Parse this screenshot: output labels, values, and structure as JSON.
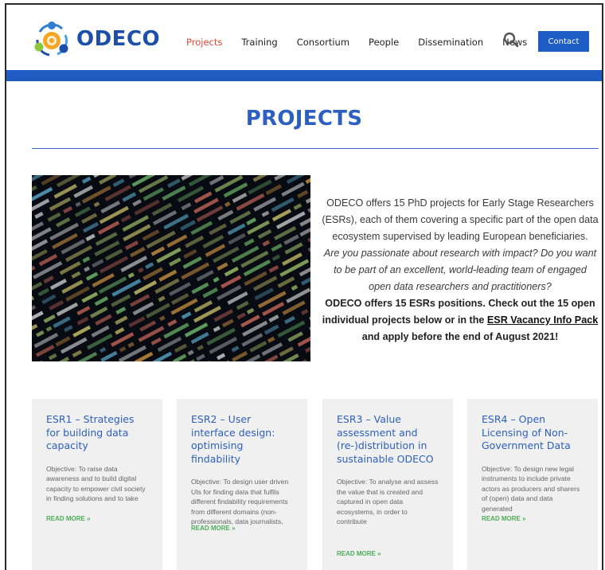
{
  "brand": {
    "name": "ODECO"
  },
  "nav": {
    "items": [
      {
        "label": "Projects",
        "active": true
      },
      {
        "label": "Training",
        "active": false
      },
      {
        "label": "Consortium",
        "active": false
      },
      {
        "label": "People",
        "active": false
      },
      {
        "label": "Dissemination",
        "active": false
      },
      {
        "label": "News",
        "active": false
      }
    ],
    "search_icon": "search-icon",
    "contact_label": "Contact"
  },
  "colors": {
    "primary": "#1f5bc2",
    "active_nav": "#e0483a",
    "read_more": "#4cae59",
    "card_bg": "#f1f0f0"
  },
  "page": {
    "title": "PROJECTS"
  },
  "intro": {
    "lead": "ODECO offers 15 PhD projects for Early Stage Researchers (ESRs), each of them covering a specific part of the open data ecosystem supervised by leading European beneficiaries.",
    "question": "Are you passionate about research with impact? Do you want to be part of an excellent, world-leading team of engaged open data researchers and practitioners?",
    "cta_before": "ODECO offers 15 ESRs positions. Check out the 15 open individual projects below or in the ",
    "cta_link": "ESR Vacancy Info Pack",
    "cta_after": " and apply before the end of August 2021!"
  },
  "projects": [
    {
      "title": "ESR1 – Strategies for building data capacity",
      "desc": "Objective: To raise data awareness and to build digital capacity to empower civil society in finding solutions and to take",
      "more": "READ MORE »"
    },
    {
      "title": "ESR2 – User interface design: optimising findability",
      "desc": "Objective: To design user driven UIs for finding data that fulfils different findability requirements from different domains (non-professionals, data journalists,",
      "more": "READ MORE »"
    },
    {
      "title": "ESR3 – Value assessment and (re-)distribution in sustainable ODECO",
      "desc": "Objective: To analyse and assess the value that is created and captured in open data ecosystems, in order to contribute",
      "more": "READ MORE »"
    },
    {
      "title": "ESR4 – Open Licensing of Non-Government Data",
      "desc": "Objective: To design new legal instruments to include private actors as producers and sharers of (open) data and data generated",
      "more": "READ MORE »"
    }
  ]
}
